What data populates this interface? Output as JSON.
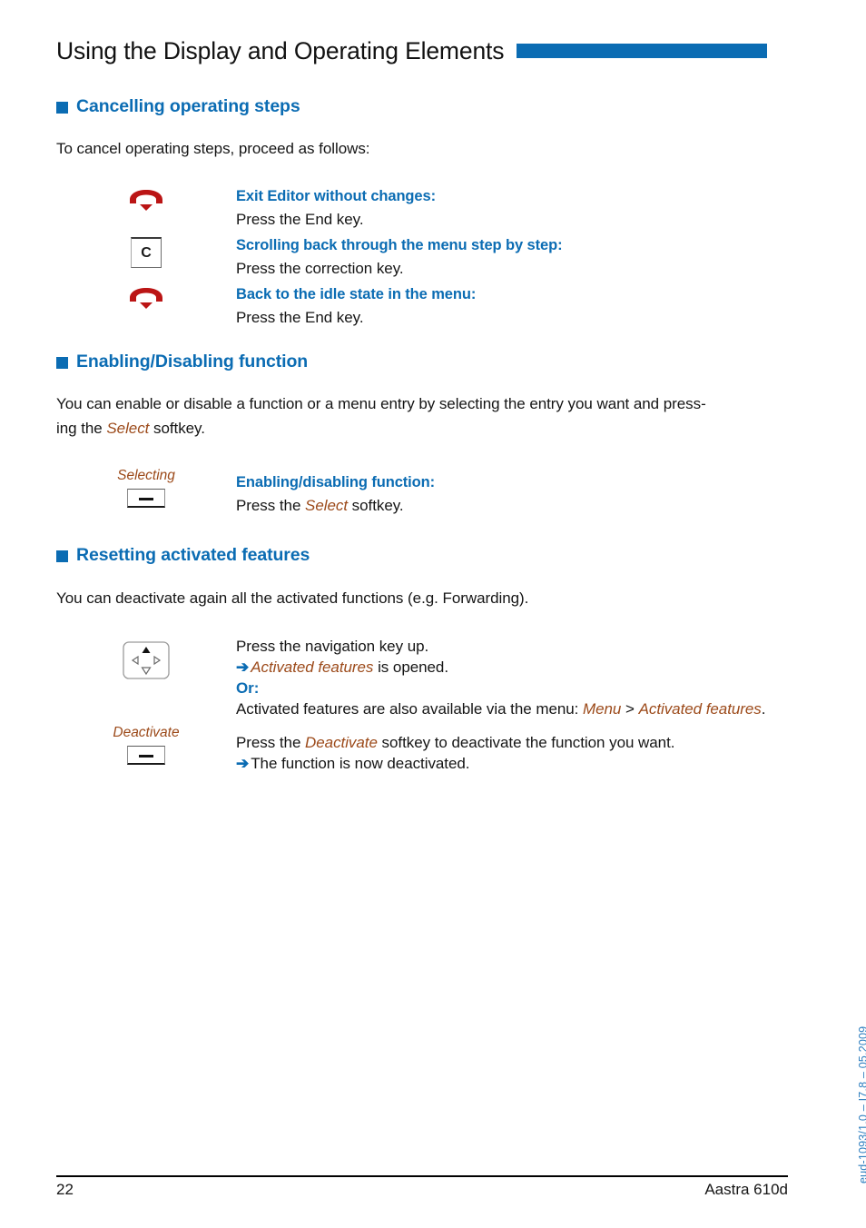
{
  "header": {
    "title": "Using the Display and Operating Elements",
    "bar_color": "#0b6cb3"
  },
  "sections": [
    {
      "heading": "Cancelling operating steps",
      "intro": "To cancel operating steps, proceed as follows:",
      "rows": [
        {
          "icon": "end-key-icon",
          "title": "Exit Editor without changes:",
          "line1": "Press the End key."
        },
        {
          "icon": "correction-key-icon",
          "icon_label": "C",
          "title": "Scrolling back through the menu step by step:",
          "line1": "Press the correction key."
        },
        {
          "icon": "end-key-icon",
          "title": "Back to the idle state in the menu:",
          "line1": "Press the End key."
        }
      ]
    },
    {
      "heading": "Enabling/Disabling function",
      "paragraph_part1": "You can enable or disable a function or a menu entry by selecting the entry you want and press-",
      "paragraph_part2_pre": "ing the ",
      "paragraph_part2_em": "Select",
      "paragraph_part2_post": " softkey.",
      "rows": [
        {
          "icon": "softkey-icon",
          "softkey_label": "Selecting",
          "title": "Enabling/disabling function:",
          "line1_pre": "Press the ",
          "line1_em": "Select",
          "line1_post": " softkey."
        }
      ]
    },
    {
      "heading": "Resetting activated features",
      "paragraph": "You can deactivate again all the activated functions (e.g. Forwarding).",
      "rows": [
        {
          "icon": "navigation-key-icon",
          "line1": "Press the navigation key up.",
          "arrow": "➔",
          "line2_em": "Activated features",
          "line2_post": " is opened.",
          "line3_or": "Or:",
          "line4_pre": "Activated features are also available via the menu: ",
          "line4_em1": "Menu",
          "line4_mid": " > ",
          "line4_em2": "Activated features",
          "line4_post": "."
        },
        {
          "icon": "softkey-icon",
          "softkey_label": "Deactivate",
          "line1_pre": "Press the ",
          "line1_em": "Deactivate",
          "line1_post": " softkey to deactivate the function you want.",
          "arrow": "➔",
          "line2": "The function is now deactivated."
        }
      ]
    }
  ],
  "footer": {
    "page_number": "22",
    "device": "Aastra 610d",
    "side_note": "eud-1093/1.0 – I7.8 – 05.2009"
  }
}
